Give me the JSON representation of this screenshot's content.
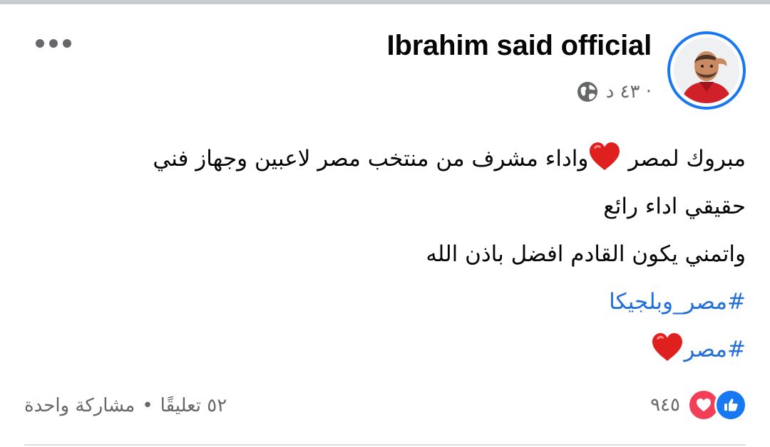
{
  "post": {
    "author": "Ibrahim said official",
    "time": "٤٣ د ·",
    "privacy_icon": "globe-icon",
    "more_icon": "more-horizontal-icon",
    "body": {
      "line1_a": "مبروك لمصر",
      "line1_b": "واداء مشرف من منتخب مصر  لاعبين وجهاز فني",
      "line2": "حقيقي اداء رائع",
      "line3": "واتمني يكون القادم افضل باذن الله",
      "hashtag1": "#مصر_وبلجيكا",
      "hashtag2": "#مصر"
    },
    "reactions": {
      "count": "٩٤٥",
      "types": [
        "like-icon",
        "love-icon"
      ]
    },
    "stats": {
      "comments": "٥٢ تعليقًا",
      "separator": "•",
      "shares": "مشاركة واحدة"
    }
  },
  "colors": {
    "accent": "#1877f2",
    "hashtag": "#216fdb",
    "heart": "#e0201e",
    "love": "#f33e58",
    "secondary_text": "#65676b"
  }
}
